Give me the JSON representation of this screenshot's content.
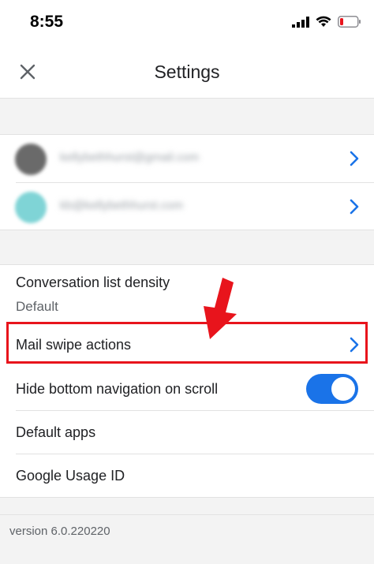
{
  "status_bar": {
    "time": "8:55"
  },
  "header": {
    "title": "Settings"
  },
  "accounts": [
    {
      "email": "kellybethhurst@gmail.com",
      "avatar_color": "#6a6a6a"
    },
    {
      "email": "kb@kellybethhurst.com",
      "avatar_color": "#7fd4d6"
    }
  ],
  "settings": {
    "density_label": "Conversation list density",
    "density_value": "Default",
    "swipe_label": "Mail swipe actions",
    "hide_nav_label": "Hide bottom navigation on scroll",
    "hide_nav_enabled": true,
    "default_apps_label": "Default apps",
    "usage_id_label": "Google Usage ID"
  },
  "footer": {
    "version": "version 6.0.220220"
  },
  "colors": {
    "accent": "#1a73e8",
    "highlight": "#e8141c",
    "band": "#f3f3f3"
  },
  "icons": {
    "close": "close-icon",
    "chevron": "chevron-right-icon",
    "annotation": "red-arrow-icon"
  }
}
